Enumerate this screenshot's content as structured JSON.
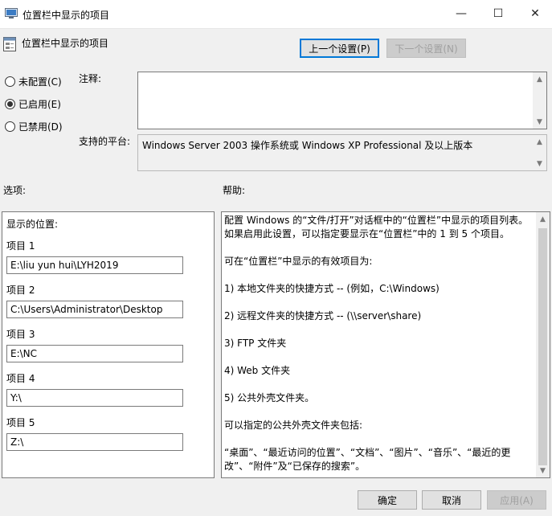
{
  "window": {
    "title": "位置栏中显示的项目",
    "minimize": "—",
    "maximize": "☐",
    "close": "✕"
  },
  "header": {
    "policy_name": "位置栏中显示的项目",
    "prev_button": "上一个设置(P)",
    "next_button": "下一个设置(N)"
  },
  "state": {
    "options": [
      {
        "label": "未配置(C)",
        "selected": false
      },
      {
        "label": "已启用(E)",
        "selected": true
      },
      {
        "label": "已禁用(D)",
        "selected": false
      }
    ]
  },
  "comment": {
    "label": "注释:",
    "value": ""
  },
  "platform": {
    "label": "支持的平台:",
    "value": "Windows Server 2003 操作系统或 Windows XP Professional 及以上版本"
  },
  "options_pane": {
    "label": "选项:",
    "heading": "显示的位置:",
    "items": [
      {
        "label": "项目 1",
        "value": "E:\\liu yun hui\\LYH2019"
      },
      {
        "label": "项目 2",
        "value": "C:\\Users\\Administrator\\Desktop"
      },
      {
        "label": "项目 3",
        "value": "E:\\NC"
      },
      {
        "label": "项目 4",
        "value": "Y:\\"
      },
      {
        "label": "项目 5",
        "value": "Z:\\"
      }
    ]
  },
  "help_pane": {
    "label": "帮助:",
    "paragraphs": [
      "配置 Windows 的“文件/打开”对话框中的“位置栏”中显示的项目列表。如果启用此设置，可以指定要显示在“位置栏”中的 1 到 5 个项目。",
      "可在“位置栏”中显示的有效项目为:",
      "1) 本地文件夹的快捷方式 -- (例如，C:\\Windows)",
      "2) 远程文件夹的快捷方式 -- (\\\\server\\share)",
      "3) FTP 文件夹",
      "4) Web 文件夹",
      "5) 公共外壳文件夹。",
      "可以指定的公共外壳文件夹包括:",
      "“桌面”、“最近访问的位置”、“文档”、“图片”、“音乐”、“最近的更改”、“附件”及“已保存的搜索”。"
    ]
  },
  "footer": {
    "ok": "确定",
    "cancel": "取消",
    "apply": "应用(A)"
  }
}
